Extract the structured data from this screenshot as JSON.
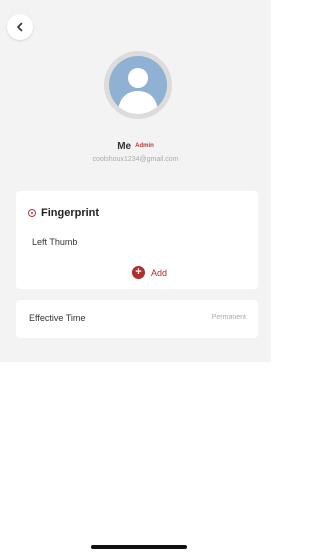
{
  "header": {
    "back_icon": "chevron-left-icon"
  },
  "profile": {
    "avatar_icon": "person-icon",
    "name": "Me",
    "role": "Admin",
    "email": "coolshoux1234@gmail.com"
  },
  "fingerprint": {
    "icon": "fingerprint-dot-icon",
    "title": "Fingerprint",
    "items": [
      "Left Thumb"
    ],
    "add_label": "Add",
    "add_icon": "plus-icon"
  },
  "effective_time": {
    "label": "Effective Time",
    "value": "Permanent"
  },
  "colors": {
    "accent": "#b02e2e",
    "panel_bg": "#f3f3f3",
    "avatar_bg": "#8fb1d3"
  }
}
